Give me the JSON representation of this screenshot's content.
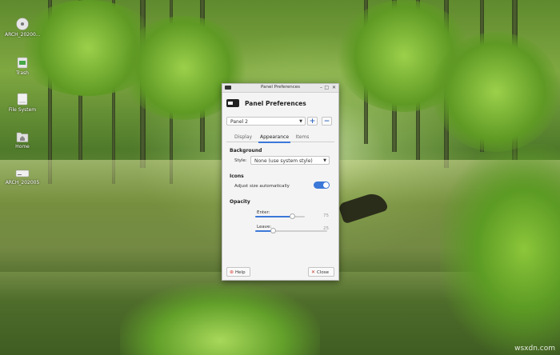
{
  "desktop": {
    "icons": [
      {
        "label": "ARCH_20200…",
        "icon": "disc-icon"
      },
      {
        "label": "Trash",
        "icon": "trash-icon"
      },
      {
        "label": "File System",
        "icon": "drive-icon"
      },
      {
        "label": "Home",
        "icon": "home-folder-icon"
      },
      {
        "label": "ARCH_202005",
        "icon": "usb-drive-icon"
      }
    ],
    "watermark": "wsxdn.com"
  },
  "window": {
    "title": "Panel Preferences",
    "heading": "Panel Preferences",
    "panel_select": "Panel 2",
    "add_panel_symbol": "+",
    "remove_panel_symbol": "−",
    "tabs": [
      "Display",
      "Appearance",
      "Items"
    ],
    "active_tab": "Appearance",
    "background": {
      "section": "Background",
      "style_label": "Style:",
      "style_value": "None (use system style)"
    },
    "icons": {
      "section": "Icons",
      "adjust_label": "Adjust size automatically",
      "adjust_on": true
    },
    "opacity": {
      "section": "Opacity",
      "enter_label": "Enter:",
      "enter_value": 75,
      "leave_label": "Leave:",
      "leave_value": 25
    },
    "help_label": "Help",
    "close_label": "Close"
  },
  "colors": {
    "accent": "#3b78d8",
    "help_icon": "#d9342b",
    "close_icon": "#c0392b"
  }
}
